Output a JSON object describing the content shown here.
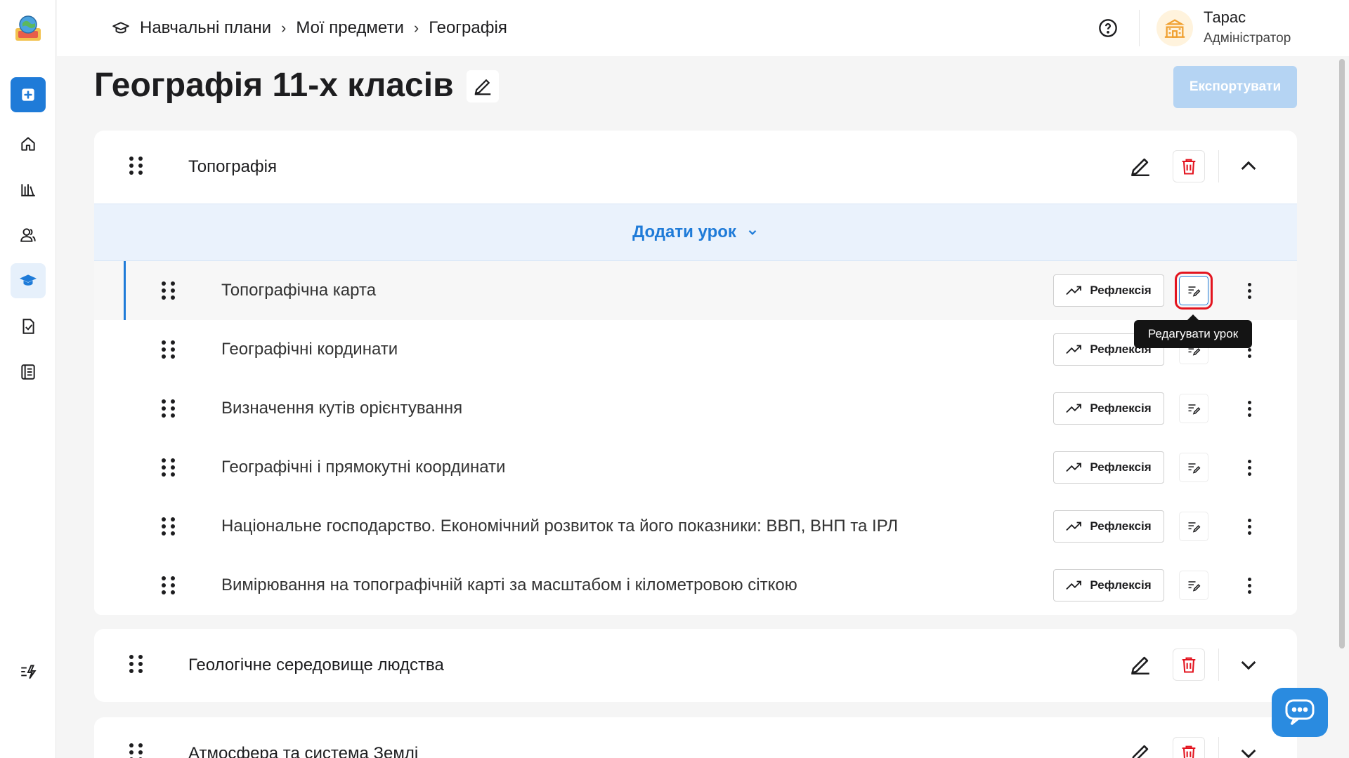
{
  "sidebar": {
    "logo_icon": "school-globe-logo",
    "items": [
      {
        "name": "add",
        "icon": "plus-square-icon"
      },
      {
        "name": "home",
        "icon": "home-icon"
      },
      {
        "name": "library",
        "icon": "books-icon"
      },
      {
        "name": "users",
        "icon": "users-icon"
      },
      {
        "name": "curriculum",
        "icon": "graduation-cap-icon"
      },
      {
        "name": "tasks",
        "icon": "checked-document-icon"
      },
      {
        "name": "journal",
        "icon": "journal-icon"
      },
      {
        "name": "activity",
        "icon": "lightning-list-icon"
      }
    ]
  },
  "header": {
    "breadcrumb_icon": "graduation-cap-icon",
    "breadcrumbs": [
      "Навчальні плани",
      "Мої предмети",
      "Географія"
    ],
    "user": {
      "name": "Тарас",
      "role": "Адміністратор"
    }
  },
  "page": {
    "title": "Географія 11-х класів",
    "export_label": "Експортувати"
  },
  "modules": [
    {
      "title": "Топографія",
      "expanded": true,
      "add_lesson_label": "Додати урок",
      "lessons": [
        {
          "title": "Топографічна карта",
          "reflection_label": "Рефлексія"
        },
        {
          "title": "Географічні кординати",
          "reflection_label": "Рефлексія"
        },
        {
          "title": "Визначення кутів орієнтування",
          "reflection_label": "Рефлексія"
        },
        {
          "title": "Географічні і прямокутні координати",
          "reflection_label": "Рефлексія"
        },
        {
          "title": "Національне господарство. Економічний розвиток та його показники: ВВП, ВНП та ІРЛ",
          "reflection_label": "Рефлексія"
        },
        {
          "title": "Вимірювання на топографічній карті за масштабом і кілометровою сіткою",
          "reflection_label": "Рефлексія"
        }
      ]
    },
    {
      "title": "Геологічне середовище людства",
      "expanded": false
    },
    {
      "title": "Атмосфера та система Землі",
      "expanded": false
    }
  ],
  "tooltip": {
    "text": "Редагувати урок"
  },
  "colors": {
    "accent": "#1f7bd8",
    "danger": "#e3141f",
    "export_disabled": "#b5d4f3"
  }
}
